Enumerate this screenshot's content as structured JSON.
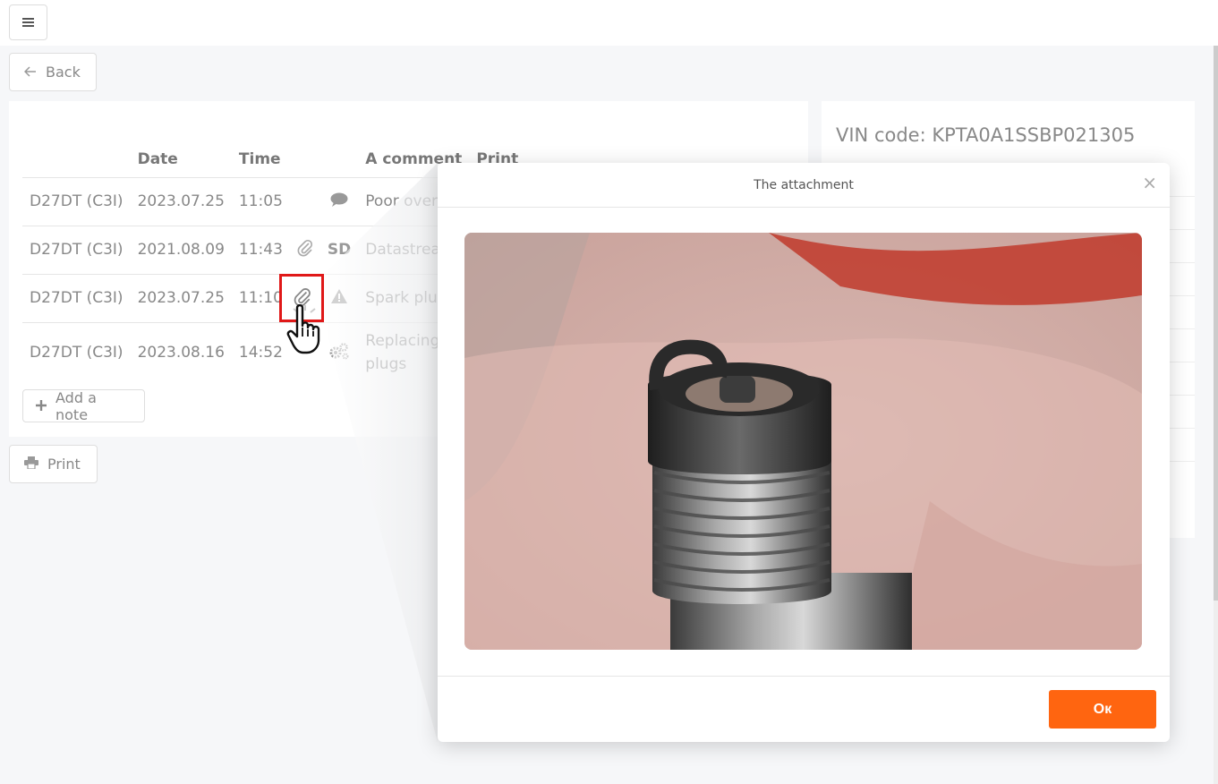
{
  "topbar": {
    "menu_icon": "hamburger-icon"
  },
  "back": {
    "label": "Back",
    "icon": "arrow-left-icon"
  },
  "print": {
    "label": "Print",
    "icon": "printer-icon"
  },
  "notes": {
    "headers": {
      "model": "",
      "date": "Date",
      "time": "Time",
      "comment": "A comment",
      "print": "Print"
    },
    "rows": [
      {
        "model": "D27DT (C3I)",
        "date": "2023.07.25",
        "time": "11:05",
        "attach": "",
        "type_icon": "comment-icon",
        "type_text": "",
        "comment": "Poor over"
      },
      {
        "model": "D27DT (C3I)",
        "date": "2021.08.09",
        "time": "11:43",
        "attach": "paperclip-icon",
        "type_icon": "",
        "type_text": "SD",
        "comment": "Datastrea"
      },
      {
        "model": "D27DT (C3I)",
        "date": "2023.07.25",
        "time": "11:10",
        "attach": "paperclip-icon",
        "type_icon": "warning-icon",
        "type_text": "",
        "comment": "Spark plug"
      },
      {
        "model": "D27DT (C3I)",
        "date": "2023.08.16",
        "time": "14:52",
        "attach": "",
        "type_icon": "gears-icon",
        "type_text": "",
        "comment": "Replacing plugs"
      }
    ],
    "add_note_label": "Add a note"
  },
  "vehicle": {
    "vin": "VIN code: KPTA0A1SSBP021305"
  },
  "modal": {
    "title": "The attachment",
    "close": "×",
    "image": "spark-plug-photo",
    "ok_label": "Oк"
  },
  "colors": {
    "accent": "#ff6510",
    "highlight": "#e01818"
  }
}
